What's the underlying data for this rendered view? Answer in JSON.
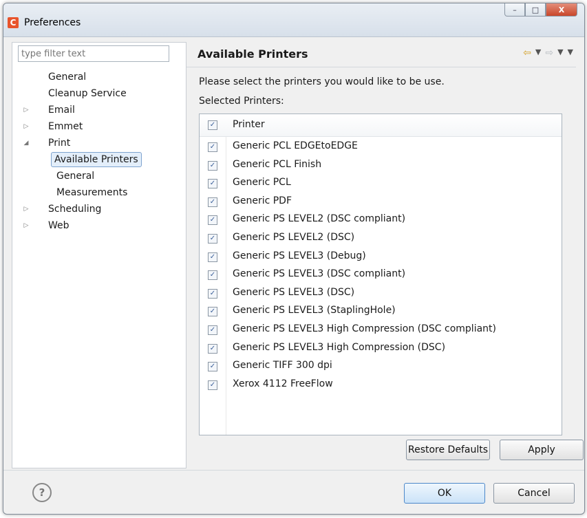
{
  "window": {
    "title": "Preferences",
    "app_icon": "C",
    "minimize_label": "–",
    "maximize_label": "□",
    "close_label": "X"
  },
  "sidebar": {
    "filter_placeholder": "type filter text",
    "items": [
      {
        "label": "General",
        "level": 0,
        "expander": ""
      },
      {
        "label": "Cleanup Service",
        "level": 0,
        "expander": ""
      },
      {
        "label": "Email",
        "level": 0,
        "expander": "▷"
      },
      {
        "label": "Emmet",
        "level": 0,
        "expander": "▷"
      },
      {
        "label": "Print",
        "level": 0,
        "expander": "◢"
      },
      {
        "label": "Available Printers",
        "level": 1,
        "expander": "",
        "selected": true
      },
      {
        "label": "General",
        "level": 1,
        "expander": ""
      },
      {
        "label": "Measurements",
        "level": 1,
        "expander": ""
      },
      {
        "label": "Scheduling",
        "level": 0,
        "expander": "▷"
      },
      {
        "label": "Web",
        "level": 0,
        "expander": "▷"
      }
    ]
  },
  "main": {
    "title": "Available Printers",
    "description": "Please select the printers you would like to be use.",
    "selected_label": "Selected Printers:",
    "table": {
      "header": "Printer",
      "header_checked": true,
      "rows": [
        {
          "name": "Generic PCL EDGEtoEDGE",
          "checked": true
        },
        {
          "name": "Generic PCL Finish",
          "checked": true
        },
        {
          "name": "Generic PCL",
          "checked": true
        },
        {
          "name": "Generic PDF",
          "checked": true
        },
        {
          "name": "Generic PS LEVEL2 (DSC compliant)",
          "checked": true
        },
        {
          "name": "Generic PS LEVEL2 (DSC)",
          "checked": true
        },
        {
          "name": "Generic PS LEVEL3 (Debug)",
          "checked": true
        },
        {
          "name": "Generic PS LEVEL3 (DSC compliant)",
          "checked": true
        },
        {
          "name": "Generic PS LEVEL3 (DSC)",
          "checked": true
        },
        {
          "name": "Generic PS LEVEL3 (StaplingHole)",
          "checked": true
        },
        {
          "name": "Generic PS LEVEL3 High Compression (DSC compliant)",
          "checked": true
        },
        {
          "name": "Generic PS LEVEL3 High Compression (DSC)",
          "checked": true
        },
        {
          "name": "Generic TIFF 300 dpi",
          "checked": true
        },
        {
          "name": "Xerox 4112 FreeFlow",
          "checked": true
        }
      ]
    },
    "restore_defaults_label": "Restore Defaults",
    "apply_label": "Apply"
  },
  "footer": {
    "help_label": "?",
    "ok_label": "OK",
    "cancel_label": "Cancel"
  }
}
